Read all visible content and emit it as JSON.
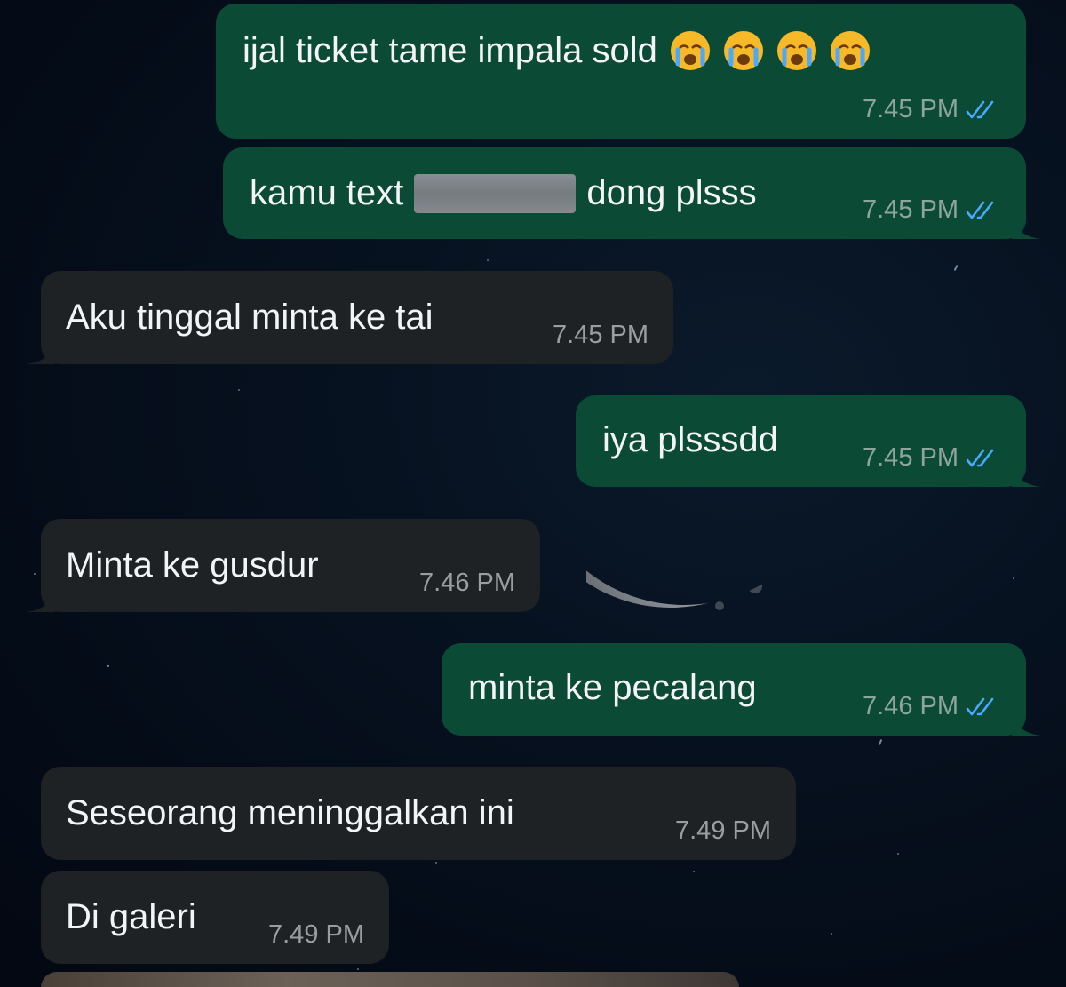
{
  "chat": {
    "messages": [
      {
        "direction": "outgoing",
        "text": "ijal ticket tame impala sold",
        "emoji": "loudly-crying-face x4",
        "time": "7.45 PM",
        "status": "read"
      },
      {
        "direction": "outgoing",
        "text_before": "kamu text",
        "redacted": true,
        "text_after": "dong plsss",
        "time": "7.45 PM",
        "status": "read"
      },
      {
        "direction": "incoming",
        "text": "Aku tinggal minta ke tai",
        "time": "7.45 PM"
      },
      {
        "direction": "outgoing",
        "text": "iya plsssdd",
        "time": "7.45 PM",
        "status": "read"
      },
      {
        "direction": "incoming",
        "text": "Minta ke gusdur",
        "time": "7.46 PM"
      },
      {
        "direction": "outgoing",
        "text": "minta ke pecalang",
        "time": "7.46 PM",
        "status": "read"
      },
      {
        "direction": "incoming",
        "text": "Seseorang meninggalkan ini",
        "time": "7.49 PM"
      },
      {
        "direction": "incoming",
        "text": "Di galeri",
        "time": "7.49 PM"
      }
    ]
  },
  "colors": {
    "outgoing_bubble": "#0b4a35",
    "incoming_bubble": "#1e2224",
    "read_tick": "#4aa8ff",
    "background": "#050c18"
  },
  "icons": {
    "read_receipt": "double-check-icon",
    "emoji": "loudly-crying-face-emoji",
    "wallpaper": "crescent-moon"
  }
}
